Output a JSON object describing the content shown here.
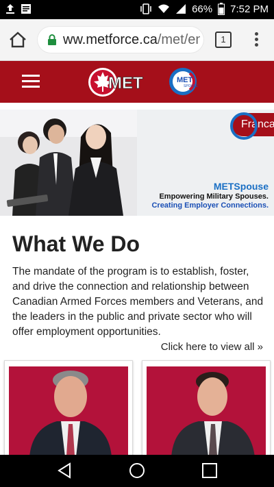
{
  "status_bar": {
    "battery": "66%",
    "time": "7:52 PM",
    "icons": [
      "upload-icon",
      "notes-icon",
      "vibrate-icon",
      "wifi-icon",
      "signal-icon",
      "battery-icon"
    ]
  },
  "browser": {
    "url_main": "ww.metforce.ca",
    "url_path": "/met/en/",
    "tab_count": "1"
  },
  "site_header": {
    "logo_text": "MET",
    "spouse_logo_text": "MET",
    "spouse_logo_sub": "SPOUSE"
  },
  "hero": {
    "language_button": "Franca",
    "brand": "METSpouse",
    "tagline": "Empowering Military Spouses.",
    "tagline2": "Creating Employer Connections."
  },
  "section": {
    "title": "What We Do",
    "body": "The mandate of the program is to establish, foster, and drive the connection and relationship between Canadian Armed Forces members and Veterans, and the leaders in the public and private sector who will offer employment opportunities.",
    "view_all": "Click here to view all »"
  },
  "colors": {
    "brand_red": "#a50f1a",
    "card_red": "#b3123a",
    "accent_blue": "#1a6fc4"
  }
}
